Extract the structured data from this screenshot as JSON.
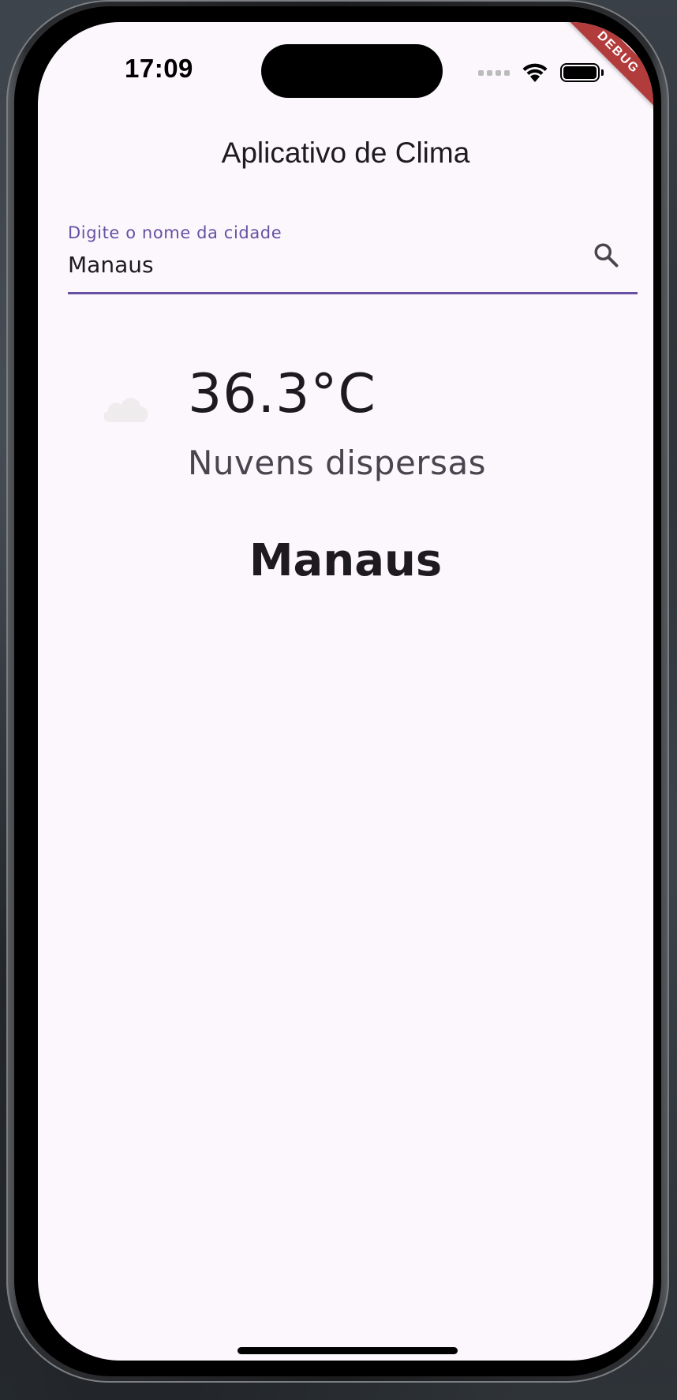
{
  "status_bar": {
    "time": "17:09",
    "debug_label": "DEBUG"
  },
  "app": {
    "title": "Aplicativo de Clima"
  },
  "search": {
    "label": "Digite o nome da cidade",
    "value": "Manaus",
    "icon": "search-icon"
  },
  "weather": {
    "icon": "cloud-icon",
    "temperature": "36.3°C",
    "description": "Nuvens dispersas",
    "city": "Manaus"
  },
  "colors": {
    "accent": "#6750a4",
    "background": "#fcf7fd",
    "text": "#1d1b20",
    "debug_banner": "#b23b3b"
  }
}
